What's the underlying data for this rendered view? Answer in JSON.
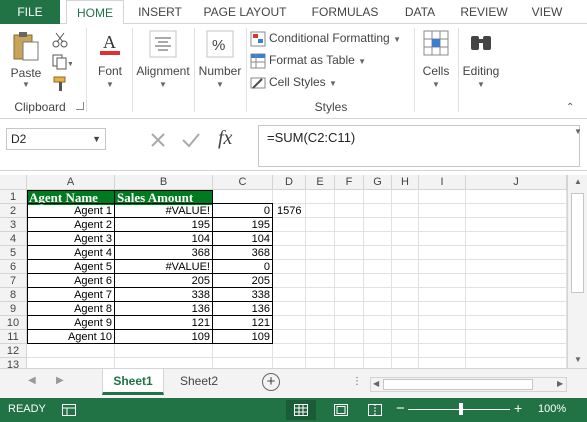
{
  "ribbon_tabs": [
    "FILE",
    "HOME",
    "INSERT",
    "PAGE LAYOUT",
    "FORMULAS",
    "DATA",
    "REVIEW",
    "VIEW"
  ],
  "clipboard": {
    "paste": "Paste",
    "group": "Clipboard"
  },
  "font": {
    "label": "Font"
  },
  "alignment": {
    "label": "Alignment"
  },
  "number": {
    "label": "Number"
  },
  "styles": {
    "conditional": "Conditional Formatting",
    "format_table": "Format as Table",
    "cell_styles": "Cell Styles",
    "group": "Styles"
  },
  "cells": {
    "label": "Cells"
  },
  "editing": {
    "label": "Editing"
  },
  "formula_bar": {
    "name_box": "D2",
    "formula": "=SUM(C2:C11)",
    "fx": "fx"
  },
  "columns": [
    "A",
    "B",
    "C",
    "D",
    "E",
    "F",
    "G",
    "H",
    "I",
    "J"
  ],
  "rows": [
    "1",
    "2",
    "3",
    "4",
    "5",
    "6",
    "7",
    "8",
    "9",
    "10",
    "11",
    "12",
    "13"
  ],
  "table": {
    "headers": [
      "Agent Name",
      "Sales Amount"
    ],
    "rows": [
      [
        "Agent 1",
        "#VALUE!",
        "0"
      ],
      [
        "Agent 2",
        "195",
        "195"
      ],
      [
        "Agent 3",
        "104",
        "104"
      ],
      [
        "Agent 4",
        "368",
        "368"
      ],
      [
        "Agent 5",
        "#VALUE!",
        "0"
      ],
      [
        "Agent 6",
        "205",
        "205"
      ],
      [
        "Agent 7",
        "338",
        "338"
      ],
      [
        "Agent 8",
        "136",
        "136"
      ],
      [
        "Agent 9",
        "121",
        "121"
      ],
      [
        "Agent 10",
        "109",
        "109"
      ]
    ],
    "d2": "1576"
  },
  "sheets": [
    "Sheet1",
    "Sheet2"
  ],
  "status": {
    "ready": "READY",
    "zoom": "100%"
  },
  "colors": {
    "excel_green": "#217346",
    "header_fill": "#007a1f"
  }
}
